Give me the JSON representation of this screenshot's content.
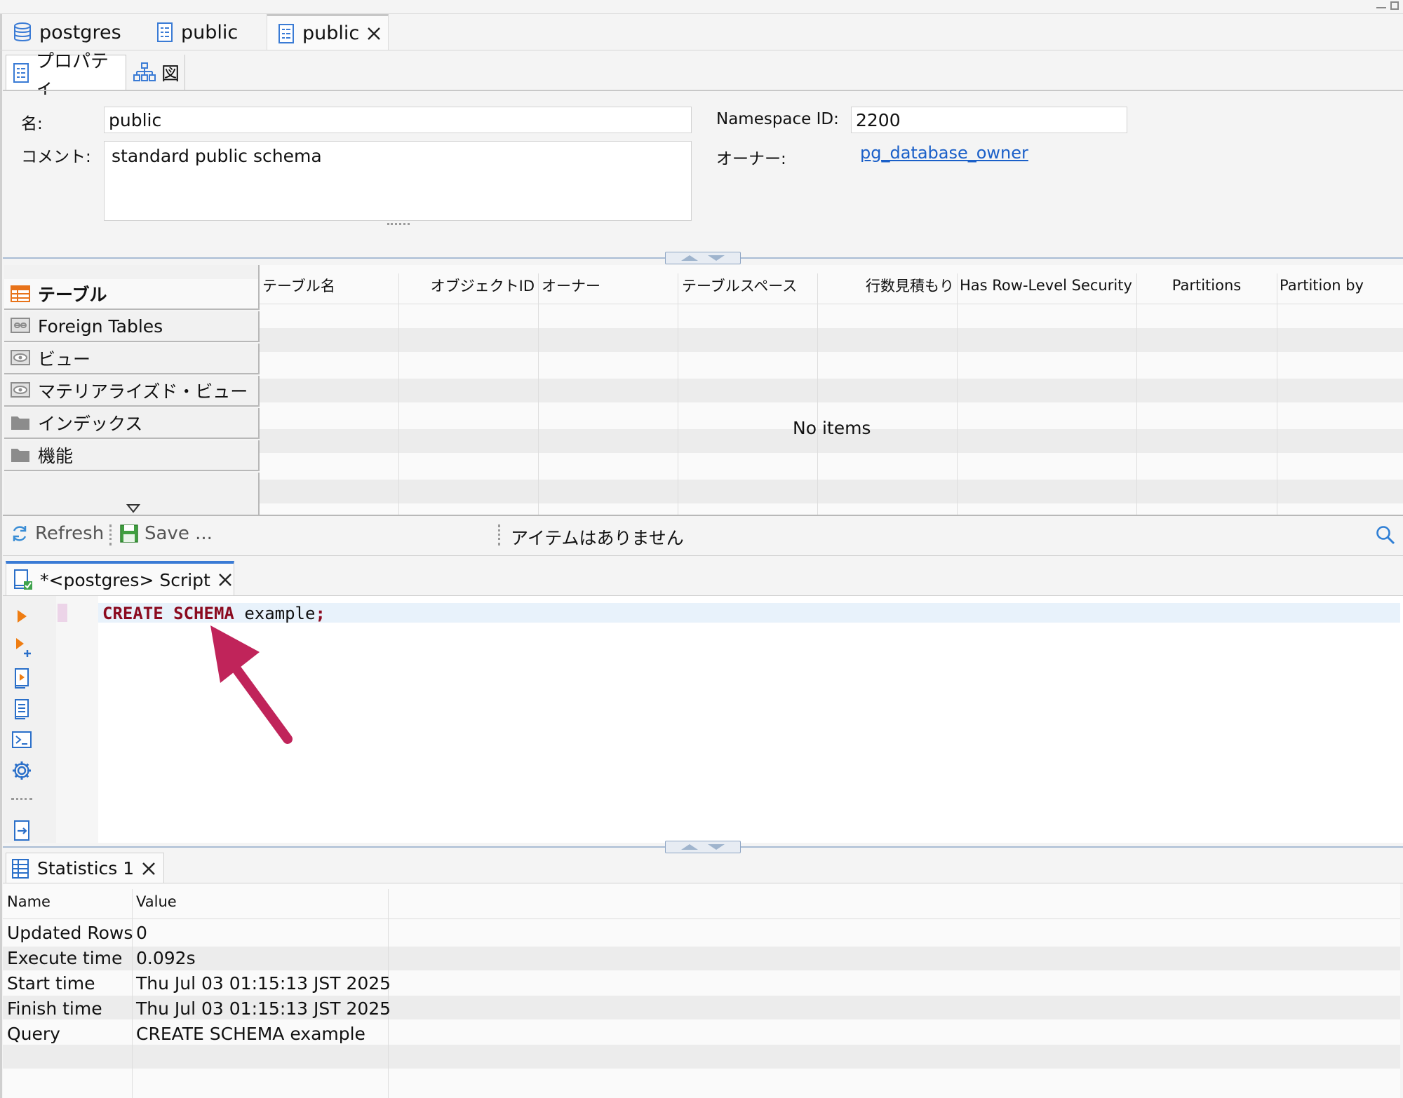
{
  "editor_tabs": [
    {
      "label": "postgres",
      "icon": "database-icon"
    },
    {
      "label": "public",
      "icon": "schema-doc-icon"
    },
    {
      "label": "public",
      "icon": "schema-doc-icon",
      "closable": true
    }
  ],
  "sub_tabs": [
    {
      "label": "プロパティ",
      "icon": "properties-icon"
    },
    {
      "label": "図",
      "icon": "diagram-icon"
    }
  ],
  "properties": {
    "name_label": "名:",
    "name_value": "public",
    "comment_label": "コメント:",
    "comment_value": "standard public schema",
    "namespace_label": "Namespace ID:",
    "namespace_value": "2200",
    "owner_label": "オーナー:",
    "owner_value": "pg_database_owner"
  },
  "categories": [
    {
      "label": "テーブル",
      "icon": "table-icon",
      "active": true
    },
    {
      "label": "Foreign Tables",
      "icon": "foreign-table-icon"
    },
    {
      "label": "ビュー",
      "icon": "view-icon"
    },
    {
      "label": "マテリアライズド・ビュー",
      "icon": "view-icon"
    },
    {
      "label": "インデックス",
      "icon": "folder-icon"
    },
    {
      "label": "機能",
      "icon": "folder-icon"
    }
  ],
  "table": {
    "columns": [
      "テーブル名",
      "オブジェクトID",
      "オーナー",
      "テーブルスペース",
      "行数見積もり",
      "Has Row-Level Security",
      "Partitions",
      "Partition by"
    ],
    "empty_text": "No items"
  },
  "toolbar": {
    "refresh_label": "Refresh",
    "save_label": "Save ...",
    "status_text": "アイテムはありません"
  },
  "script_tab": {
    "label": "*<postgres> Script"
  },
  "script": {
    "kw1": "CREATE",
    "kw2": "SCHEMA",
    "ident": "example",
    "semi": ";"
  },
  "colors": {
    "keyword": "#8b0a1f",
    "annotation_arrow": "#c0245a",
    "link": "#1a5fc8",
    "accent_tab": "#3a7bd5"
  },
  "stats_tab": {
    "label": "Statistics 1"
  },
  "stats": {
    "headers": [
      "Name",
      "Value"
    ],
    "rows": [
      {
        "name": "Updated Rows",
        "value": "0"
      },
      {
        "name": "Execute time",
        "value": "0.092s"
      },
      {
        "name": "Start time",
        "value": "Thu Jul 03 01:15:13 JST 2025"
      },
      {
        "name": "Finish time",
        "value": "Thu Jul 03 01:15:13 JST 2025"
      },
      {
        "name": "Query",
        "value": "CREATE SCHEMA example"
      }
    ]
  }
}
